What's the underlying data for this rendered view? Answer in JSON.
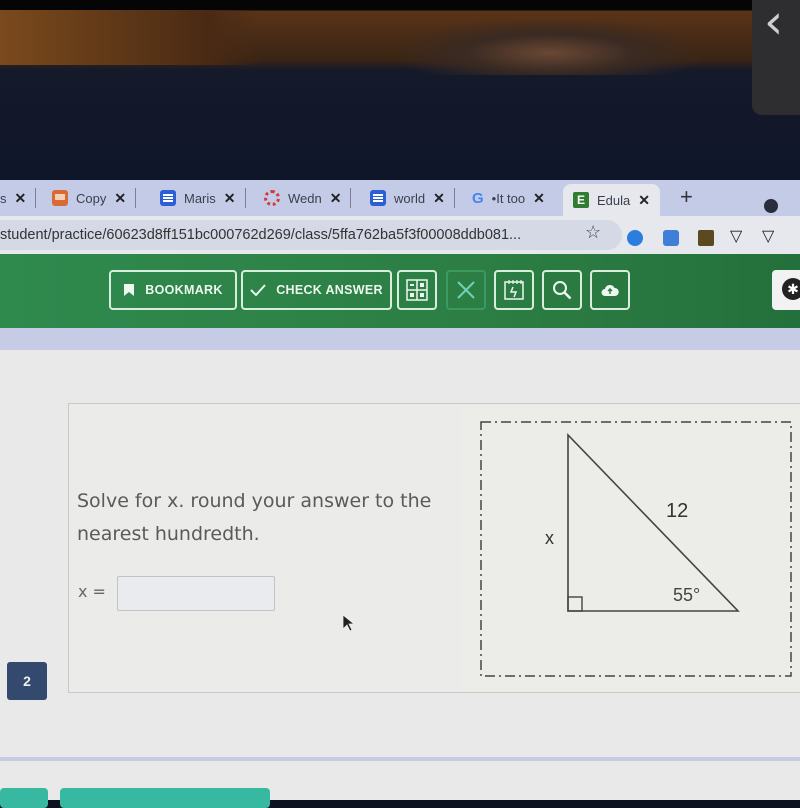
{
  "browser": {
    "tabs": [
      {
        "label": "s",
        "icon": "unknown-icon",
        "active": false
      },
      {
        "label": "Copy",
        "icon": "slides-icon",
        "active": false
      },
      {
        "label": "Maris",
        "icon": "docs-icon",
        "active": false
      },
      {
        "label": "Wedn",
        "icon": "canvas-icon",
        "active": false
      },
      {
        "label": "world",
        "icon": "docs-icon",
        "active": false
      },
      {
        "label": "•It too",
        "icon": "google-icon",
        "active": false
      },
      {
        "label": "Edula",
        "icon": "edulastic-icon",
        "active": true
      }
    ],
    "close_glyph": "✕",
    "new_tab_glyph": "+",
    "url": "student/practice/60623d8ff151bc000762d269/class/5ffa762ba5f3f00008ddb081...",
    "star_glyph": "☆",
    "extensions": [
      "blue-circle-extension",
      "cloud-extension",
      "classroom-extension",
      "shield-extension",
      "shield-extension"
    ]
  },
  "side_tab": {
    "glyph": "‹"
  },
  "toolbar": {
    "bookmark_label": "BOOKMARK",
    "check_answer_label": "CHECK ANSWER",
    "accent": "#2f8a4e"
  },
  "question": {
    "number": "2",
    "prompt": "Solve for x. round your answer to the nearest hundredth.",
    "answer_label": "x =",
    "answer_value": ""
  },
  "figure": {
    "hypotenuse_label": "12",
    "leg_label": "x",
    "angle_label": "55°"
  }
}
